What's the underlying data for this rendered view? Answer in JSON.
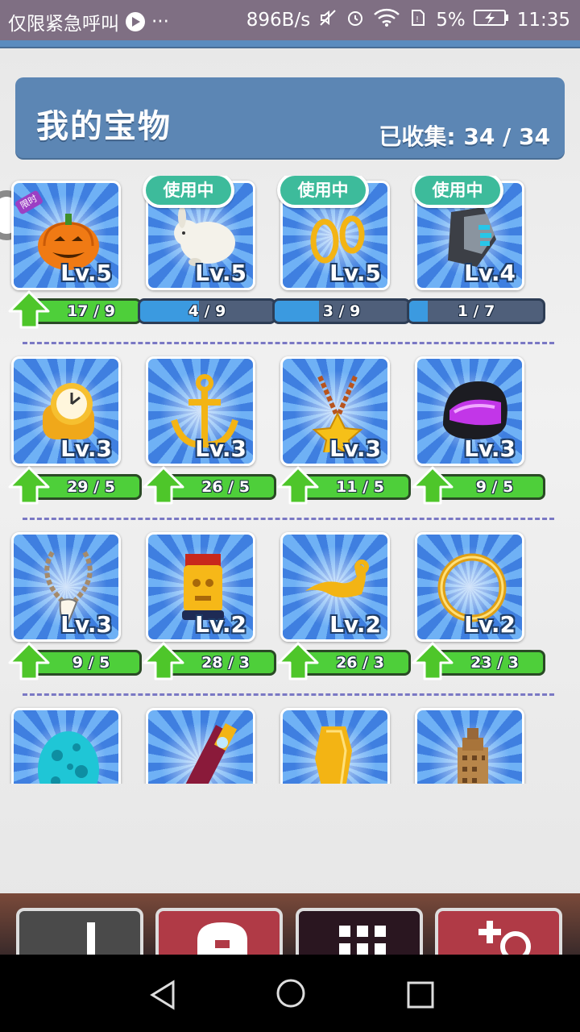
{
  "status_bar": {
    "carrier": "仅限紧急呼叫",
    "more": "···",
    "speed": "896B/s",
    "battery": "5%",
    "time": "11:35"
  },
  "header": {
    "title": "我的宝物",
    "collected": "已收集: 34 / 34"
  },
  "colors": {
    "header_bg": "#5c86b4",
    "in_use_badge": "#3dbb9b",
    "upgrade_bar": "#4ecf3a",
    "progress_bar": "#3b9ae0"
  },
  "treasures": [
    {
      "item": "pumpkin-icon",
      "level": "Lv.5",
      "progress": "17 / 9",
      "upgradable": true,
      "in_use": false,
      "limited": "限时"
    },
    {
      "item": "white-rabbit-icon",
      "level": "Lv.5",
      "progress": "4 / 9",
      "upgradable": false,
      "fill": 0.44,
      "in_use": true,
      "badge": "使用中"
    },
    {
      "item": "gold-earrings-icon",
      "level": "Lv.5",
      "progress": "3 / 9",
      "upgradable": false,
      "fill": 0.33,
      "in_use": true,
      "badge": "使用中"
    },
    {
      "item": "gauntlet-icon",
      "level": "Lv.4",
      "progress": "1 / 7",
      "upgradable": false,
      "fill": 0.14,
      "in_use": true,
      "badge": "使用中"
    },
    {
      "item": "gold-watch-icon",
      "level": "Lv.3",
      "progress": "29 / 5",
      "upgradable": true,
      "in_use": false
    },
    {
      "item": "anchor-icon",
      "level": "Lv.3",
      "progress": "26 / 5",
      "upgradable": true,
      "in_use": false
    },
    {
      "item": "star-necklace-icon",
      "level": "Lv.3",
      "progress": "11 / 5",
      "upgradable": true,
      "in_use": false
    },
    {
      "item": "helmet-icon",
      "level": "Lv.3",
      "progress": "9 / 5",
      "upgradable": true,
      "in_use": false
    },
    {
      "item": "fang-necklace-icon",
      "level": "Lv.3",
      "progress": "9 / 5",
      "upgradable": true,
      "in_use": false
    },
    {
      "item": "golden-idol-icon",
      "level": "Lv.2",
      "progress": "28 / 3",
      "upgradable": true,
      "in_use": false
    },
    {
      "item": "magic-lamp-icon",
      "level": "Lv.2",
      "progress": "26 / 3",
      "upgradable": true,
      "in_use": false
    },
    {
      "item": "gold-ring-icon",
      "level": "Lv.2",
      "progress": "23 / 3",
      "upgradable": true,
      "in_use": false
    },
    {
      "item": "spotted-egg-icon",
      "level": "",
      "progress": "",
      "upgradable": false,
      "in_use": false
    },
    {
      "item": "scroll-icon",
      "level": "",
      "progress": "",
      "upgradable": false,
      "in_use": false
    },
    {
      "item": "golden-blade-icon",
      "level": "",
      "progress": "",
      "upgradable": false,
      "in_use": false
    },
    {
      "item": "tower-icon",
      "level": "",
      "progress": "",
      "upgradable": false,
      "in_use": false
    }
  ],
  "bottom_nav": [
    {
      "name": "back-icon"
    },
    {
      "name": "treasure-chest-icon"
    },
    {
      "name": "grid-menu-icon"
    },
    {
      "name": "add-vehicle-icon"
    }
  ]
}
